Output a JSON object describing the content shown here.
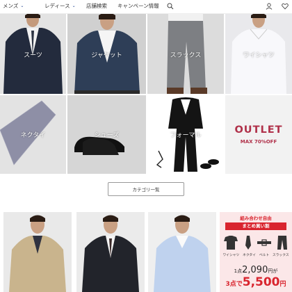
{
  "header": {
    "nav": [
      {
        "label": "メンズ",
        "has_chevron": true
      },
      {
        "label": "レディース",
        "has_chevron": true
      },
      {
        "label": "店舗検索",
        "has_chevron": false
      },
      {
        "label": "キャンペーン情報",
        "has_chevron": false
      }
    ],
    "icons": [
      "search-icon",
      "user-icon",
      "heart-icon"
    ]
  },
  "categories": [
    {
      "label": "スーツ"
    },
    {
      "label": "ジャケット"
    },
    {
      "label": "スラックス"
    },
    {
      "label": "ワイシャツ"
    },
    {
      "label": "ネクタイ"
    },
    {
      "label": "シューズ"
    },
    {
      "label": "フォーマル"
    },
    {
      "label": "OUTLET",
      "sub": "MAX 70%OFF"
    }
  ],
  "category_list_button": "カテゴリ一覧",
  "promo": {
    "tag": "組み合わせ自由",
    "banner": "まとめ買い割",
    "items": [
      "ワイシャツ",
      "ネクタイ",
      "ベルト",
      "スラックス"
    ],
    "line1_prefix": "1点",
    "line1_price": "2,090",
    "line1_suffix": "円が",
    "line2_prefix": "3点で",
    "line2_price": "5,500",
    "line2_suffix": "円"
  },
  "colors": {
    "accent_blue": "#1a3d8f",
    "outlet_red": "#b0314a",
    "promo_red": "#d9242e",
    "promo_bg": "#fbe7e8"
  }
}
